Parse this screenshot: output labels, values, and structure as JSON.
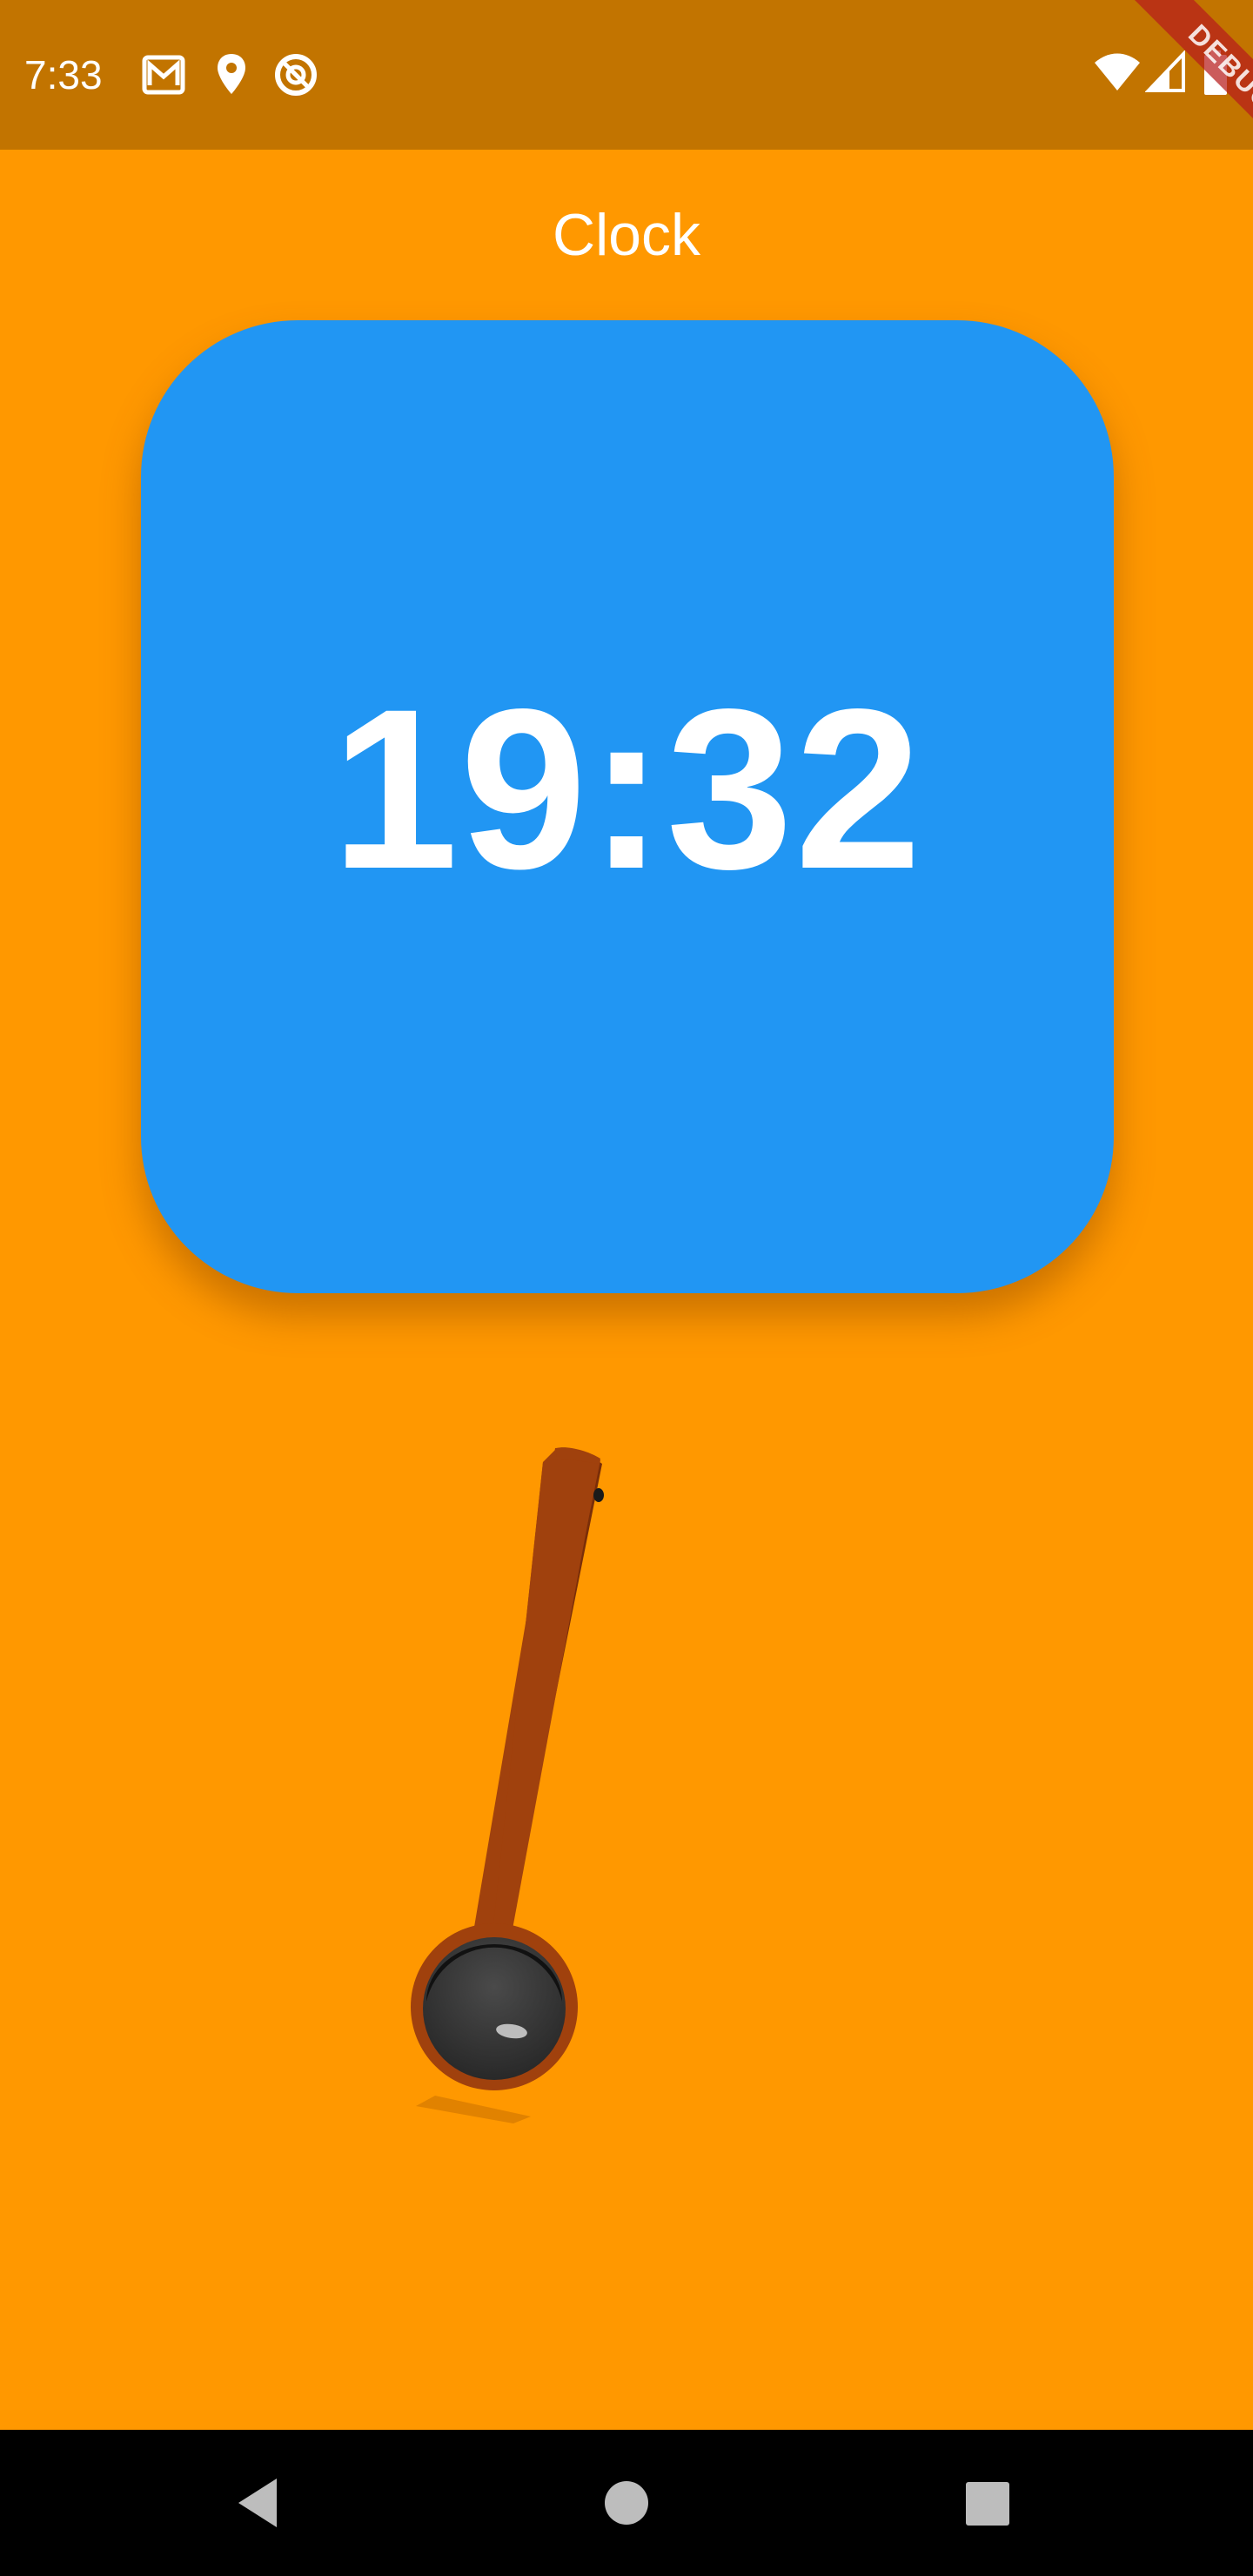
{
  "status_bar": {
    "time": "7:33",
    "left_icons": [
      "gallery-mail-icon",
      "location-pin-icon",
      "data-saver-icon"
    ],
    "right_icons": [
      "wifi-icon",
      "cell-signal-icon",
      "battery-icon"
    ]
  },
  "debug_banner": {
    "label": "DEBUG"
  },
  "app": {
    "title": "Clock",
    "clock_time": "19:32"
  },
  "lever": {
    "icon": "lever-handle-icon"
  },
  "nav_bar": {
    "buttons": [
      "back-icon",
      "home-icon",
      "recents-icon"
    ]
  },
  "colors": {
    "background": "#FF9800",
    "status_bar": "#C27400",
    "card": "#2196F3",
    "lever_wood": "#A0410D",
    "knob": "#3A3A3A"
  }
}
